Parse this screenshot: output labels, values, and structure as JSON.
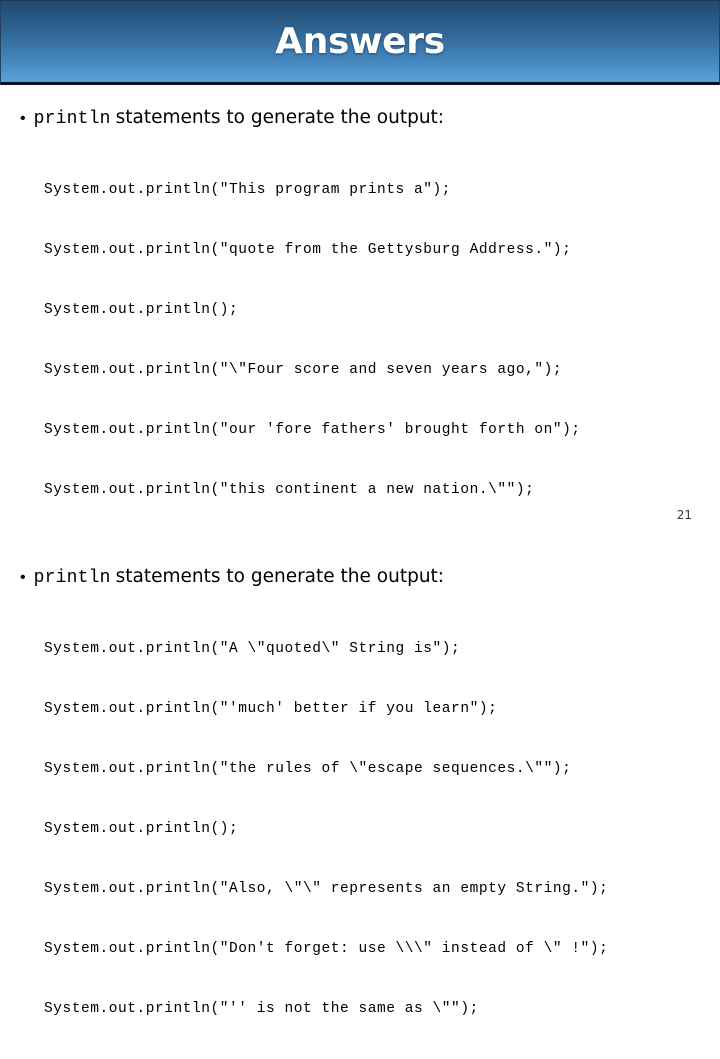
{
  "slide": {
    "title": "Answers",
    "page_number": "21",
    "accent_color": "#3b77ab",
    "title_color": "#ffffff",
    "text_color": "#000000"
  },
  "sections": [
    {
      "bullet_marker": "•",
      "bullet_code": "println",
      "bullet_text": "statements to generate the output:",
      "code_lines": [
        "System.out.println(\"This program prints a\");",
        "System.out.println(\"quote from the Gettysburg Address.\");",
        "System.out.println();",
        "System.out.println(\"\\\"Four score and seven years ago,\");",
        "System.out.println(\"our 'fore fathers' brought forth on\");",
        "System.out.println(\"this continent a new nation.\\\"\");"
      ]
    },
    {
      "bullet_marker": "•",
      "bullet_code": "println",
      "bullet_text": "statements to generate the output:",
      "code_lines": [
        "System.out.println(\"A \\\"quoted\\\" String is\");",
        "System.out.println(\"'much' better if you learn\");",
        "System.out.println(\"the rules of \\\"escape sequences.\\\"\");",
        "System.out.println();",
        "System.out.println(\"Also, \\\"\\\" represents an empty String.\");",
        "System.out.println(\"Don't forget: use \\\\\\\" instead of \\\" !\");",
        "System.out.println(\"'' is not the same as \\\"\");"
      ]
    }
  ]
}
